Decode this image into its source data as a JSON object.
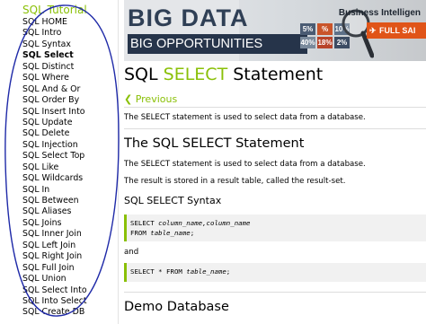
{
  "sidebar": {
    "heading": "SQL Tutorial",
    "items": [
      {
        "label": "SQL HOME"
      },
      {
        "label": "SQL Intro"
      },
      {
        "label": "SQL Syntax"
      },
      {
        "label": "SQL Select",
        "active": true
      },
      {
        "label": "SQL Distinct"
      },
      {
        "label": "SQL Where"
      },
      {
        "label": "SQL And & Or"
      },
      {
        "label": "SQL Order By"
      },
      {
        "label": "SQL Insert Into"
      },
      {
        "label": "SQL Update"
      },
      {
        "label": "SQL Delete"
      },
      {
        "label": "SQL Injection"
      },
      {
        "label": "SQL Select Top"
      },
      {
        "label": "SQL Like"
      },
      {
        "label": "SQL Wildcards"
      },
      {
        "label": "SQL In"
      },
      {
        "label": "SQL Between"
      },
      {
        "label": "SQL Aliases"
      },
      {
        "label": "SQL Joins"
      },
      {
        "label": "SQL Inner Join"
      },
      {
        "label": "SQL Left Join"
      },
      {
        "label": "SQL Right Join"
      },
      {
        "label": "SQL Full Join"
      },
      {
        "label": "SQL Union"
      },
      {
        "label": "SQL Select Into"
      },
      {
        "label": "SQL Into Select"
      },
      {
        "label": "SQL Create DB"
      }
    ]
  },
  "banner": {
    "title_line1": "BIG DATA",
    "title_line2": "BIG OPPORTUNITIES",
    "tagline": "Business Intelligen",
    "cta": "FULL SAI",
    "grid_cells": [
      "5%",
      "%",
      "10%",
      "40%",
      "18%",
      "2%"
    ]
  },
  "content": {
    "title_prefix": "SQL ",
    "title_keyword": "SELECT",
    "title_suffix": " Statement",
    "prev_link": "❮ Previous",
    "intro": "The SELECT statement is used to select data from a database.",
    "section_heading": "The SQL SELECT Statement",
    "section_p1": "The SELECT statement is used to select data from a database.",
    "section_p2": "The result is stored in a result table, called the result-set.",
    "syntax_heading": "SQL SELECT Syntax",
    "syntax1_kw1": "SELECT ",
    "syntax1_arg1": "column_name,column_name",
    "syntax1_kw2": "FROM ",
    "syntax1_arg2": "table_name",
    "syntax1_end": ";",
    "and_label": "and",
    "syntax2_kw": "SELECT * FROM ",
    "syntax2_arg": "table_name",
    "syntax2_end": ";",
    "demo_heading": "Demo Database"
  },
  "colors": {
    "accent": "#8ac007",
    "annotation": "#1f2aa8",
    "banner_dark": "#26344a",
    "banner_cta": "#e05418"
  }
}
